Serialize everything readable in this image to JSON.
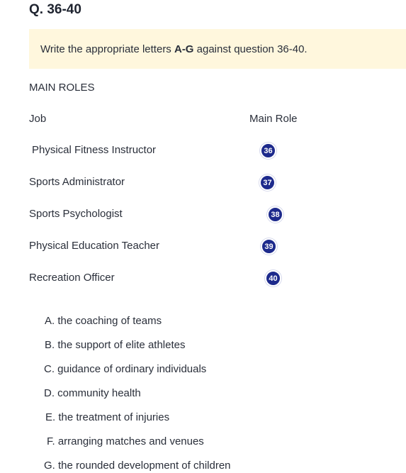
{
  "question": {
    "title": "Q. 36-40"
  },
  "instruction": {
    "prefix": "Write the appropriate letters ",
    "bold": "A-G",
    "suffix": " against question 36-40."
  },
  "section": {
    "heading": "MAIN ROLES",
    "col_job": "Job",
    "col_role": "Main Role"
  },
  "rows": [
    {
      "job": "Physical Fitness Instructor",
      "number": "36"
    },
    {
      "job": "Sports Administrator",
      "number": "37"
    },
    {
      "job": "Sports Psychologist",
      "number": "38"
    },
    {
      "job": "Physical Education Teacher",
      "number": "39"
    },
    {
      "job": "Recreation Officer",
      "number": "40"
    }
  ],
  "options": [
    {
      "letter": "A.",
      "text": "the coaching of teams"
    },
    {
      "letter": "B.",
      "text": "the support of elite athletes"
    },
    {
      "letter": "C.",
      "text": "guidance of ordinary individuals"
    },
    {
      "letter": "D.",
      "text": "community health"
    },
    {
      "letter": "E.",
      "text": "the treatment of injuries"
    },
    {
      "letter": "F.",
      "text": "arranging matches and venues"
    },
    {
      "letter": "G.",
      "text": "the rounded development of children"
    }
  ],
  "colors": {
    "badge": "#1d2a8c",
    "instruction_bg": "#fff7dd"
  }
}
